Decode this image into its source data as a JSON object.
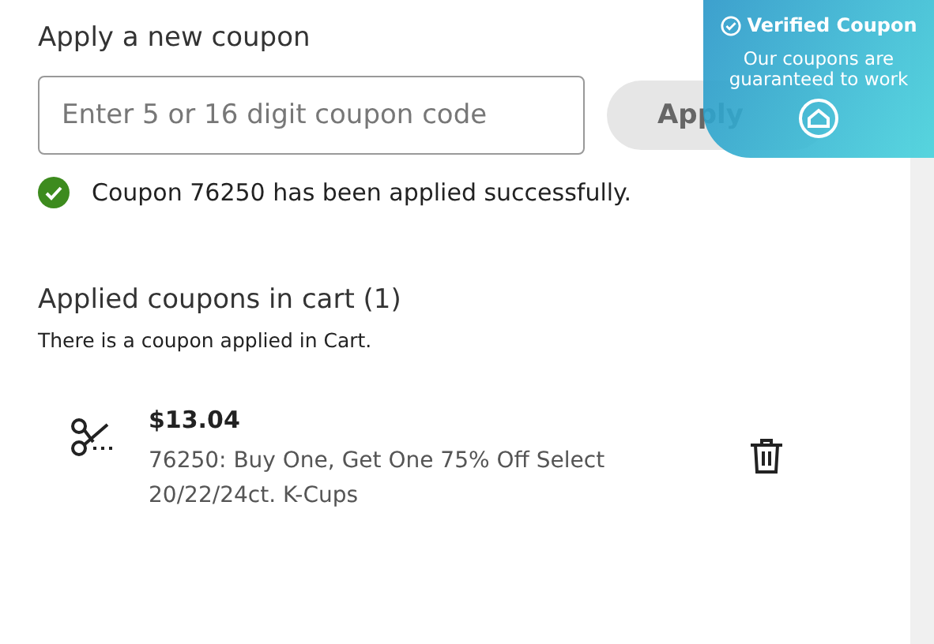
{
  "apply_section": {
    "title": "Apply a new coupon",
    "input": {
      "placeholder": "Enter 5 or 16 digit coupon code"
    },
    "apply_button": {
      "label": "Apply",
      "disabled": true
    },
    "message": {
      "kind": "success",
      "text": "Coupon 76250 has been applied successfully."
    }
  },
  "verified_badge": {
    "title": "Verified Coupon",
    "text": "Our coupons are guaranteed to work"
  },
  "applied_section": {
    "title": "Applied coupons in cart (1)",
    "note": "There is a coupon applied in Cart.",
    "coupons": [
      {
        "amount": "$13.04",
        "description": "76250: Buy One, Get One 75% Off Select 20/22/24ct. K-Cups"
      }
    ]
  }
}
